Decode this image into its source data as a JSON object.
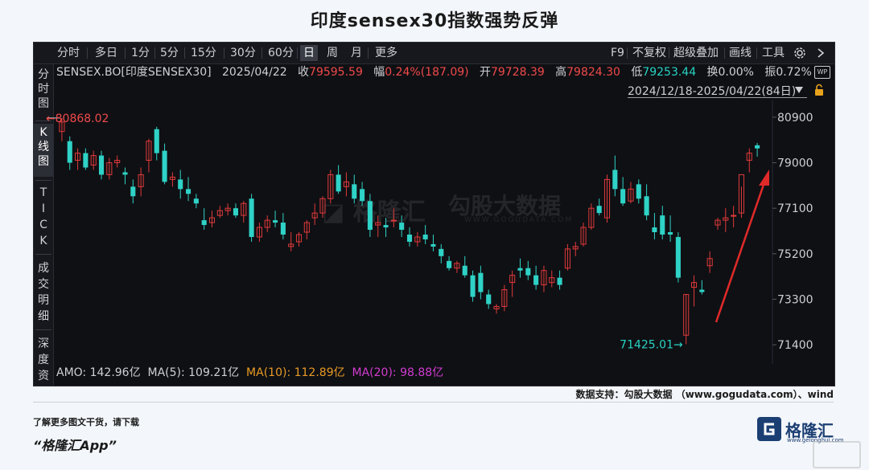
{
  "title": "印度sensex30指数强势反弹",
  "toolbar": {
    "periods": [
      "分时",
      "多日",
      "1分",
      "5分",
      "15分",
      "30分",
      "60分",
      "日",
      "周",
      "月",
      "更多"
    ],
    "active_period": "日",
    "right_items": [
      "F9",
      "不复权",
      "超级叠加",
      "画线",
      "工具"
    ],
    "icons": [
      "gear-icon",
      "chevron-right-icon"
    ]
  },
  "sidebar": {
    "tabs": [
      "分时图",
      "K线图",
      "TICK",
      "成交明细",
      "深度资"
    ],
    "active_tab": "K线图"
  },
  "info_bar": {
    "symbol": "SENSEX.BO[印度SENSEX30]",
    "date": "2025/04/22",
    "close_label": "收",
    "close_value": "79595.59",
    "change_label": "幅",
    "change_value": "0.24%(187.09)",
    "open_label": "开",
    "open_value": "79728.39",
    "high_label": "高",
    "high_value": "79824.30",
    "low_label": "低",
    "low_value": "79253.44",
    "turnover_label": "换",
    "turnover_value": "0.00%",
    "amplitude_label": "振",
    "amplitude_value": "0.72%",
    "wp_badge": "WP"
  },
  "date_range": "2024/12/18-2025/04/22(84日)",
  "bottom_bar": {
    "amo": "AMO: 142.96亿",
    "ma5": "MA(5): 109.21亿",
    "ma10": "MA(10): 112.89亿",
    "ma20": "MA(20): 98.88亿"
  },
  "colors": {
    "up": "#e03a3a",
    "down": "#2fd2c6",
    "background": "#0f1014",
    "arrow": "#e02a2a",
    "ma10": "#e89a24",
    "ma20": "#d23bd0"
  },
  "chart_data": {
    "type": "candlestick",
    "ylim": [
      70600,
      81600
    ],
    "yticks": [
      "80900",
      "79000",
      "77100",
      "75200",
      "73300",
      "71400"
    ],
    "annotations": {
      "max_label": "80868.02",
      "min_label": "71425.01"
    },
    "candles": [
      [
        80300,
        80868,
        79900,
        80700
      ],
      [
        79900,
        80100,
        78700,
        79000
      ],
      [
        79100,
        79600,
        78700,
        79400
      ],
      [
        79400,
        79600,
        78700,
        78800
      ],
      [
        78900,
        79500,
        78700,
        79300
      ],
      [
        79300,
        79500,
        78300,
        78500
      ],
      [
        78500,
        79200,
        78300,
        79000
      ],
      [
        79000,
        79300,
        78800,
        79100
      ],
      [
        78600,
        78800,
        78100,
        78500
      ],
      [
        78000,
        78300,
        77300,
        77600
      ],
      [
        78000,
        78800,
        77600,
        78500
      ],
      [
        79100,
        80000,
        78600,
        79900
      ],
      [
        80400,
        80500,
        79100,
        79400
      ],
      [
        79500,
        79800,
        78100,
        78200
      ],
      [
        78300,
        78600,
        78000,
        78400
      ],
      [
        78300,
        78700,
        77500,
        77900
      ],
      [
        77900,
        78400,
        77400,
        77700
      ],
      [
        77500,
        77700,
        77100,
        77300
      ],
      [
        76600,
        77100,
        76200,
        76400
      ],
      [
        76500,
        77000,
        76300,
        76700
      ],
      [
        76800,
        77200,
        76700,
        77000
      ],
      [
        77000,
        77300,
        76800,
        77100
      ],
      [
        77100,
        77300,
        76700,
        76800
      ],
      [
        76800,
        77400,
        76500,
        77300
      ],
      [
        77500,
        77700,
        75700,
        75900
      ],
      [
        75900,
        76500,
        75700,
        76300
      ],
      [
        76300,
        76800,
        76100,
        76600
      ],
      [
        76600,
        77000,
        76300,
        76500
      ],
      [
        76500,
        76900,
        75800,
        76000
      ],
      [
        75500,
        76100,
        75300,
        75600
      ],
      [
        75700,
        76100,
        75500,
        76000
      ],
      [
        76100,
        76600,
        75800,
        76500
      ],
      [
        76700,
        77300,
        76400,
        76900
      ],
      [
        76900,
        77600,
        76700,
        77500
      ],
      [
        77500,
        78700,
        77300,
        78500
      ],
      [
        78500,
        78900,
        77700,
        77800
      ],
      [
        78000,
        78600,
        77600,
        78200
      ],
      [
        78100,
        78500,
        77300,
        77500
      ],
      [
        77900,
        78200,
        77200,
        77400
      ],
      [
        77400,
        77700,
        75900,
        76200
      ],
      [
        76400,
        76800,
        75900,
        76500
      ],
      [
        76400,
        76700,
        75900,
        76300
      ],
      [
        76600,
        77100,
        76300,
        76600
      ],
      [
        76500,
        76800,
        75900,
        76200
      ],
      [
        76000,
        76300,
        75500,
        75700
      ],
      [
        75700,
        76100,
        75500,
        75900
      ],
      [
        76000,
        76400,
        75600,
        75800
      ],
      [
        75600,
        76000,
        75300,
        75500
      ],
      [
        75400,
        75600,
        74800,
        75100
      ],
      [
        74900,
        75100,
        74500,
        74600
      ],
      [
        74600,
        74900,
        74400,
        74800
      ],
      [
        74700,
        75100,
        74200,
        74300
      ],
      [
        74300,
        74500,
        73200,
        73400
      ],
      [
        74400,
        74700,
        73300,
        73600
      ],
      [
        73500,
        73700,
        72900,
        73100
      ],
      [
        72900,
        73100,
        72700,
        73000
      ],
      [
        73000,
        73900,
        72800,
        73700
      ],
      [
        74000,
        74500,
        73400,
        74300
      ],
      [
        74600,
        75000,
        74200,
        74500
      ],
      [
        74600,
        74900,
        74100,
        74300
      ],
      [
        74300,
        74700,
        73700,
        73900
      ],
      [
        73900,
        74700,
        73600,
        74500
      ],
      [
        74000,
        74500,
        73800,
        74200
      ],
      [
        74200,
        74500,
        73700,
        73900
      ],
      [
        74600,
        75600,
        74500,
        75400
      ],
      [
        75400,
        75700,
        75100,
        75500
      ],
      [
        75600,
        76500,
        75500,
        76300
      ],
      [
        76300,
        77300,
        76200,
        77100
      ],
      [
        77200,
        77500,
        76800,
        76900
      ],
      [
        76700,
        78500,
        76500,
        78300
      ],
      [
        78700,
        79300,
        77600,
        77900
      ],
      [
        77900,
        78400,
        77200,
        77300
      ],
      [
        77400,
        78200,
        77300,
        77900
      ],
      [
        78100,
        78300,
        77300,
        77500
      ],
      [
        77600,
        78100,
        76600,
        76800
      ],
      [
        76300,
        76900,
        75800,
        76100
      ],
      [
        76800,
        77200,
        75800,
        76000
      ],
      [
        76100,
        76800,
        75700,
        76000
      ],
      [
        75900,
        76100,
        74000,
        74200
      ],
      [
        71800,
        73500,
        71425,
        73500
      ],
      [
        73800,
        74300,
        73000,
        74000
      ],
      [
        73700,
        74100,
        73500,
        73600
      ],
      [
        74700,
        75300,
        74400,
        75000
      ],
      [
        76400,
        76700,
        76200,
        76600
      ],
      [
        76600,
        77100,
        76100,
        76700
      ],
      [
        76800,
        77200,
        76300,
        76800
      ],
      [
        76900,
        78000,
        76700,
        78500
      ],
      [
        79100,
        79600,
        78600,
        79400
      ],
      [
        79728,
        79824,
        79253,
        79596
      ]
    ]
  }
}
